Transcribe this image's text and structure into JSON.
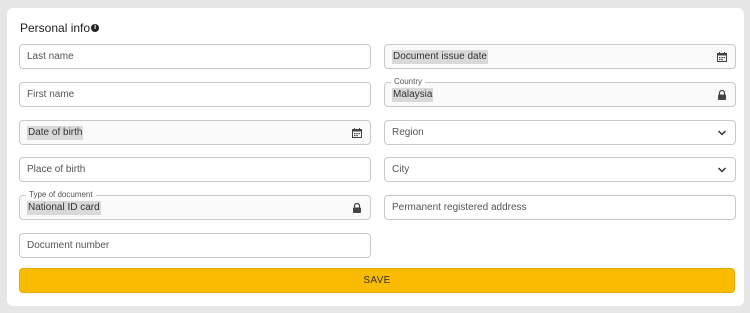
{
  "section": {
    "title": "Personal info"
  },
  "fields": {
    "last_name": {
      "placeholder": "Last name"
    },
    "first_name": {
      "placeholder": "First name"
    },
    "date_of_birth": {
      "value": "Date of birth"
    },
    "place_of_birth": {
      "placeholder": "Place of birth"
    },
    "type_of_document": {
      "label": "Type of document",
      "value": "National ID card"
    },
    "document_number": {
      "placeholder": "Document number"
    },
    "document_issue_date": {
      "value": "Document issue date"
    },
    "country": {
      "label": "Country",
      "value": "Malaysia"
    },
    "region": {
      "placeholder": "Region"
    },
    "city": {
      "placeholder": "City"
    },
    "permanent_address": {
      "placeholder": "Permanent registered address"
    }
  },
  "actions": {
    "save_label": "SAVE"
  },
  "icons": {
    "calendar": "calendar-icon",
    "lock": "lock-icon",
    "chevron": "chevron-down-icon",
    "info": "info-icon"
  },
  "colors": {
    "accent": "#fbbc00",
    "background": "#e6e6e6",
    "card": "#ffffff"
  }
}
